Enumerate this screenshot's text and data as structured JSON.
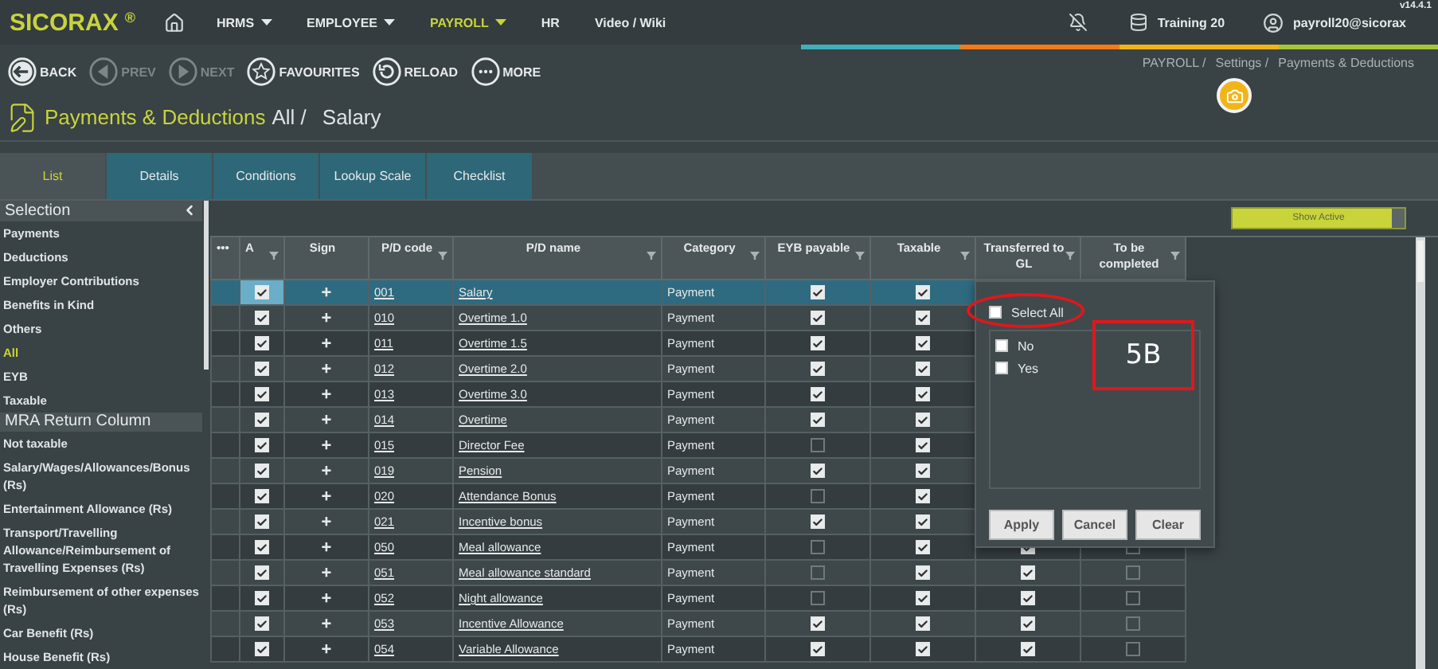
{
  "app": {
    "logo": "SICORAX",
    "logo_mark": "®",
    "version": "v14.4.1"
  },
  "nav": [
    {
      "label": "HRMS",
      "dropdown": true,
      "selected": false
    },
    {
      "label": "EMPLOYEE",
      "dropdown": true,
      "selected": false
    },
    {
      "label": "PAYROLL",
      "dropdown": true,
      "selected": true
    },
    {
      "label": "HR",
      "dropdown": false,
      "selected": false
    },
    {
      "label": "Video / Wiki",
      "dropdown": false,
      "selected": false
    }
  ],
  "status": {
    "database": "Training 20",
    "user": "payroll20@sicorax"
  },
  "toolbar": [
    {
      "label": "BACK",
      "kind": "back",
      "disabled": false
    },
    {
      "label": "PREV",
      "kind": "prev",
      "disabled": true
    },
    {
      "label": "NEXT",
      "kind": "next",
      "disabled": true
    },
    {
      "label": "FAVOURITES",
      "kind": "star",
      "disabled": false
    },
    {
      "label": "RELOAD",
      "kind": "reload",
      "disabled": false
    },
    {
      "label": "MORE",
      "kind": "more",
      "disabled": false
    }
  ],
  "breadcrumb": [
    "PAYROLL /",
    "Settings /",
    "Payments & Deductions"
  ],
  "title": {
    "module": "Payments & Deductions",
    "filter": "All /",
    "record": "Salary"
  },
  "tabs": [
    {
      "label": "List",
      "selected": true
    },
    {
      "label": "Details",
      "selected": false
    },
    {
      "label": "Conditions",
      "selected": false
    },
    {
      "label": "Lookup Scale",
      "selected": false
    },
    {
      "label": "Checklist",
      "selected": false
    }
  ],
  "sidebar": {
    "sections": [
      {
        "title": "Selection",
        "collapsible": true,
        "items": [
          {
            "label": "Payments",
            "selected": false
          },
          {
            "label": "Deductions",
            "selected": false
          },
          {
            "label": "Employer Contributions",
            "selected": false
          },
          {
            "label": "Benefits in Kind",
            "selected": false
          },
          {
            "label": "Others",
            "selected": false
          },
          {
            "label": "All",
            "selected": true
          },
          {
            "label": "EYB",
            "selected": false
          },
          {
            "label": "Taxable",
            "selected": false
          }
        ]
      },
      {
        "title": "MRA Return Column",
        "collapsible": false,
        "items": [
          {
            "label": "Not taxable",
            "selected": false
          },
          {
            "label": "Salary/Wages/Allowances/Bonus (Rs)",
            "selected": false
          },
          {
            "label": "Entertainment Allowance (Rs)",
            "selected": false
          },
          {
            "label": "Transport/Travelling Allowance/Reimbursement of Travelling Expenses (Rs)",
            "selected": false
          },
          {
            "label": "Reimbursement of other expenses (Rs)",
            "selected": false
          },
          {
            "label": "Car Benefit (Rs)",
            "selected": false
          },
          {
            "label": "House Benefit (Rs)",
            "selected": false
          }
        ]
      }
    ]
  },
  "show_active": {
    "label": "Show Active",
    "on": true
  },
  "table": {
    "columns": [
      {
        "label": "•••",
        "filter": false
      },
      {
        "label": "A",
        "filter": true
      },
      {
        "label": "Sign",
        "filter": false
      },
      {
        "label": "P/D code",
        "filter": true
      },
      {
        "label": "P/D name",
        "filter": true
      },
      {
        "label": "Category",
        "filter": true
      },
      {
        "label": "EYB payable",
        "filter": true
      },
      {
        "label": "Taxable",
        "filter": true
      },
      {
        "label": "Transferred to GL",
        "filter": true
      },
      {
        "label": "To be completed",
        "filter": true
      }
    ],
    "rows": [
      {
        "selected": true,
        "active": true,
        "sign": "+",
        "code": "001",
        "name": "Salary",
        "category": "Payment",
        "eyb": true,
        "taxable": true
      },
      {
        "selected": false,
        "active": true,
        "sign": "+",
        "code": "010",
        "name": "Overtime 1.0",
        "category": "Payment",
        "eyb": true,
        "taxable": true
      },
      {
        "selected": false,
        "active": true,
        "sign": "+",
        "code": "011",
        "name": "Overtime 1.5",
        "category": "Payment",
        "eyb": true,
        "taxable": true
      },
      {
        "selected": false,
        "active": true,
        "sign": "+",
        "code": "012",
        "name": "Overtime 2.0",
        "category": "Payment",
        "eyb": true,
        "taxable": true
      },
      {
        "selected": false,
        "active": true,
        "sign": "+",
        "code": "013",
        "name": "Overtime 3.0",
        "category": "Payment",
        "eyb": true,
        "taxable": true
      },
      {
        "selected": false,
        "active": true,
        "sign": "+",
        "code": "014",
        "name": "Overtime",
        "category": "Payment",
        "eyb": true,
        "taxable": true
      },
      {
        "selected": false,
        "active": true,
        "sign": "+",
        "code": "015",
        "name": "Director Fee",
        "category": "Payment",
        "eyb": false,
        "taxable": true
      },
      {
        "selected": false,
        "active": true,
        "sign": "+",
        "code": "019",
        "name": "Pension",
        "category": "Payment",
        "eyb": true,
        "taxable": true
      },
      {
        "selected": false,
        "active": true,
        "sign": "+",
        "code": "020",
        "name": "Attendance Bonus",
        "category": "Payment",
        "eyb": false,
        "taxable": true
      },
      {
        "selected": false,
        "active": true,
        "sign": "+",
        "code": "021",
        "name": "Incentive bonus",
        "category": "Payment",
        "eyb": true,
        "taxable": true
      },
      {
        "selected": false,
        "active": true,
        "sign": "+",
        "code": "050",
        "name": "Meal allowance",
        "category": "Payment",
        "eyb": false,
        "taxable": true,
        "gl": true,
        "completed": false
      },
      {
        "selected": false,
        "active": true,
        "sign": "+",
        "code": "051",
        "name": "Meal allowance standard",
        "category": "Payment",
        "eyb": false,
        "taxable": true,
        "gl": true,
        "completed": false
      },
      {
        "selected": false,
        "active": true,
        "sign": "+",
        "code": "052",
        "name": "Night allowance",
        "category": "Payment",
        "eyb": false,
        "taxable": true,
        "gl": true,
        "completed": false
      },
      {
        "selected": false,
        "active": true,
        "sign": "+",
        "code": "053",
        "name": "Incentive Allowance",
        "category": "Payment",
        "eyb": true,
        "taxable": true,
        "gl": true,
        "completed": false
      },
      {
        "selected": false,
        "active": true,
        "sign": "+",
        "code": "054",
        "name": "Variable Allowance",
        "category": "Payment",
        "eyb": true,
        "taxable": true,
        "gl": true,
        "completed": false
      }
    ]
  },
  "filter_popup": {
    "select_all": {
      "label": "Select All",
      "checked": false,
      "circled": true
    },
    "options": [
      {
        "label": "No",
        "checked": false
      },
      {
        "label": "Yes",
        "checked": false
      }
    ],
    "note": "5B",
    "buttons": [
      "Apply",
      "Cancel",
      "Clear"
    ]
  }
}
